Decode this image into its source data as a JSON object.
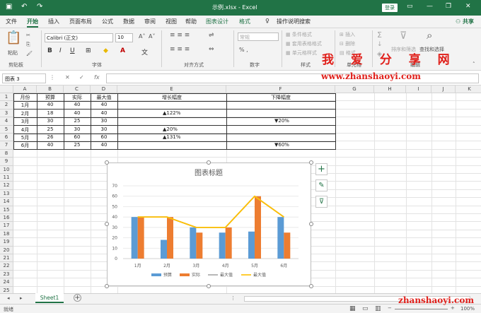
{
  "titlebar": {
    "autosave_icon": "save-icon",
    "undo": "↶",
    "redo": "↷",
    "doc_title": "示例.xlsx  -  Excel",
    "login": "登录"
  },
  "tabs": [
    "文件",
    "开始",
    "插入",
    "页面布局",
    "公式",
    "数据",
    "审阅",
    "视图",
    "帮助",
    "图表设计",
    "格式",
    "操作说明搜索"
  ],
  "share": "共享",
  "ribbon": {
    "clipboard": {
      "paste": "粘贴",
      "label": "剪贴板"
    },
    "font": {
      "name": "Calibri (正文)",
      "size": "10",
      "label": "字体",
      "bold": "B",
      "italic": "I",
      "underline": "U"
    },
    "align": {
      "label": "对齐方式"
    },
    "number": {
      "format": "常规",
      "label": "数字"
    },
    "styles": {
      "cond": "条件格式",
      "table": "套用表格格式",
      "cell": "单元格样式",
      "label": "样式"
    },
    "cells": {
      "insert": "插入",
      "delete": "删除",
      "format": "格式",
      "label": "单元格"
    },
    "edit": {
      "sort": "排序和筛选",
      "find": "查找和选择",
      "label": "编辑"
    }
  },
  "watermark": {
    "cn": "我 爱 分 享 网",
    "url": "www.zhanshaoyi.com",
    "url_bottom": "zhanshaoyi.com"
  },
  "formula_bar": {
    "name_box": "图表 3",
    "fx": "fx",
    "value": ""
  },
  "columns": [
    "A",
    "B",
    "C",
    "D",
    "E",
    "F",
    "G",
    "H",
    "I",
    "J",
    "K"
  ],
  "rows": [
    "1",
    "2",
    "3",
    "4",
    "5",
    "6",
    "7",
    "8",
    "9",
    "10",
    "11",
    "12",
    "13",
    "14",
    "15",
    "16",
    "17",
    "18",
    "19",
    "20",
    "21",
    "22",
    "23",
    "24",
    "25"
  ],
  "table": {
    "headers": [
      "月份",
      "预算",
      "实际",
      "最大值",
      "增长幅度",
      "下降幅度"
    ],
    "rows": [
      [
        "1月",
        "40",
        "40",
        "40",
        "",
        ""
      ],
      [
        "2月",
        "18",
        "40",
        "40",
        "▲122%",
        ""
      ],
      [
        "3月",
        "30",
        "25",
        "30",
        "",
        "▼20%"
      ],
      [
        "4月",
        "25",
        "30",
        "30",
        "▲20%",
        ""
      ],
      [
        "5月",
        "26",
        "60",
        "60",
        "▲131%",
        ""
      ],
      [
        "6月",
        "40",
        "25",
        "40",
        "",
        "▼60%"
      ]
    ]
  },
  "chart_data": {
    "type": "bar",
    "title": "图表标题",
    "categories": [
      "1月",
      "2月",
      "3月",
      "4月",
      "5月",
      "6月"
    ],
    "series": [
      {
        "name": "预算",
        "type": "bar",
        "color": "#5b9bd5",
        "values": [
          40,
          18,
          30,
          25,
          26,
          40
        ]
      },
      {
        "name": "实际",
        "type": "bar",
        "color": "#ed7d31",
        "values": [
          40,
          40,
          25,
          30,
          60,
          25
        ]
      },
      {
        "name": "最大值",
        "type": "line",
        "color": "#a5a5a5",
        "values": [
          40,
          40,
          30,
          30,
          60,
          40
        ]
      },
      {
        "name": "最大值",
        "type": "line",
        "color": "#ffc000",
        "values": [
          40,
          40,
          30,
          30,
          60,
          40
        ]
      }
    ],
    "ylim": [
      0,
      70
    ],
    "yticks": [
      "0",
      "10",
      "20",
      "30",
      "40",
      "50",
      "60",
      "70"
    ],
    "legend": "bottom",
    "grid": true
  },
  "chart_side": {
    "add": "+",
    "brush": "✎",
    "filter": "⊽"
  },
  "sheet": {
    "name": "Sheet1",
    "add": "+"
  },
  "status": {
    "ready": "就绪",
    "zoom": "100%"
  }
}
